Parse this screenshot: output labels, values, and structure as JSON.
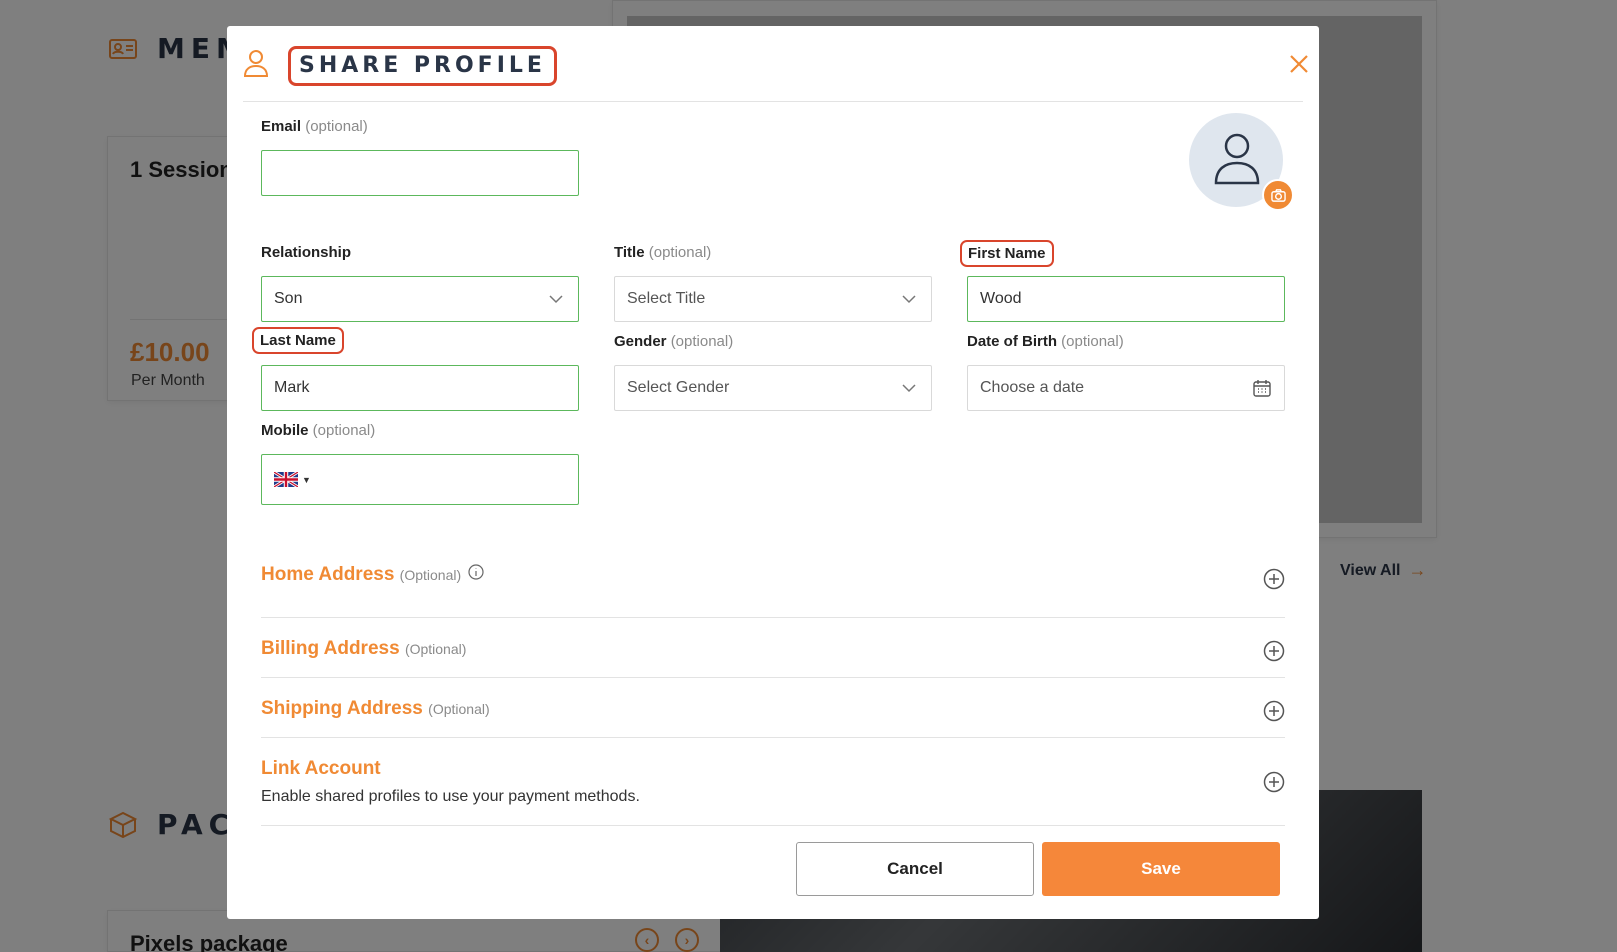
{
  "background": {
    "memberships_title": "MEM",
    "card_title": "1 Session",
    "price": "£10.00",
    "period": "Per Month",
    "view_all": "View All",
    "packages_title": "PAC",
    "package_card_title": "Pixels package"
  },
  "modal": {
    "title": "SHARE PROFILE",
    "email": {
      "label": "Email",
      "optional": "(optional)",
      "value": ""
    },
    "relationship": {
      "label": "Relationship",
      "value": "Son"
    },
    "title_field": {
      "label": "Title",
      "optional": "(optional)",
      "value": "Select Title"
    },
    "first_name": {
      "label": "First Name",
      "value": "Wood"
    },
    "last_name": {
      "label": "Last Name",
      "value": "Mark"
    },
    "gender": {
      "label": "Gender",
      "optional": "(optional)",
      "value": "Select Gender"
    },
    "dob": {
      "label": "Date of Birth",
      "optional": "(optional)",
      "value": "Choose a date"
    },
    "mobile": {
      "label": "Mobile",
      "optional": "(optional)",
      "value": ""
    },
    "sections": [
      {
        "title": "Home Address",
        "optional": "(Optional)"
      },
      {
        "title": "Billing Address",
        "optional": "(Optional)"
      },
      {
        "title": "Shipping Address",
        "optional": "(Optional)"
      },
      {
        "title": "Link Account",
        "subtitle": "Enable shared profiles to use your payment methods."
      }
    ],
    "cancel_label": "Cancel",
    "save_label": "Save"
  },
  "colors": {
    "accent": "#f08a34",
    "highlight": "#d9452c",
    "valid_border": "#5cb85c",
    "title_text": "#2a3547"
  },
  "icons": [
    "id-card-icon",
    "user-icon",
    "close-icon",
    "person-avatar-icon",
    "camera-icon",
    "chevron-down-icon",
    "calendar-icon",
    "uk-flag-icon",
    "info-icon",
    "plus-circle-icon",
    "box-icon",
    "arrow-right-icon",
    "arrow-left-circle-icon",
    "arrow-right-circle-icon"
  ]
}
